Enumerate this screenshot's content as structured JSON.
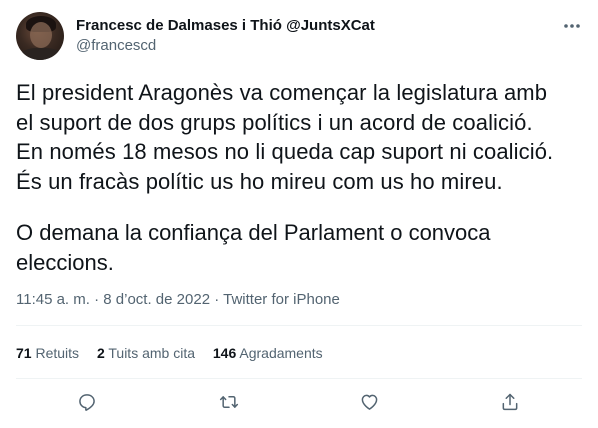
{
  "author": {
    "display_name": "Francesc de Dalmases i Thió @JuntsXCat",
    "handle": "@francescd"
  },
  "tweet": {
    "text": "El president Aragonès va començar la legislatura amb\nel suport de dos grups polítics i un acord de coalició.\nEn només 18 mesos no li queda cap suport ni coalició.\nÉs un fracàs polític us ho mireu com us ho mireu.",
    "text2": "O demana la confiança del Parlament o convoca\neleccions.",
    "time": "11:45 a. m.",
    "separator": "·",
    "date": "8 d’oct. de 2022",
    "source": "Twitter for iPhone"
  },
  "stats": {
    "retweets_count": "71",
    "retweets_label": "Retuits",
    "quotes_count": "2",
    "quotes_label": "Tuits amb cita",
    "likes_count": "146",
    "likes_label": "Agradaments"
  },
  "icons": {
    "more": "more-dots-icon",
    "reply": "reply-icon",
    "retweet": "retweet-icon",
    "like": "heart-icon",
    "share": "share-icon"
  },
  "colors": {
    "text": "#0f1419",
    "muted": "#536471",
    "divider": "#eff3f4"
  }
}
